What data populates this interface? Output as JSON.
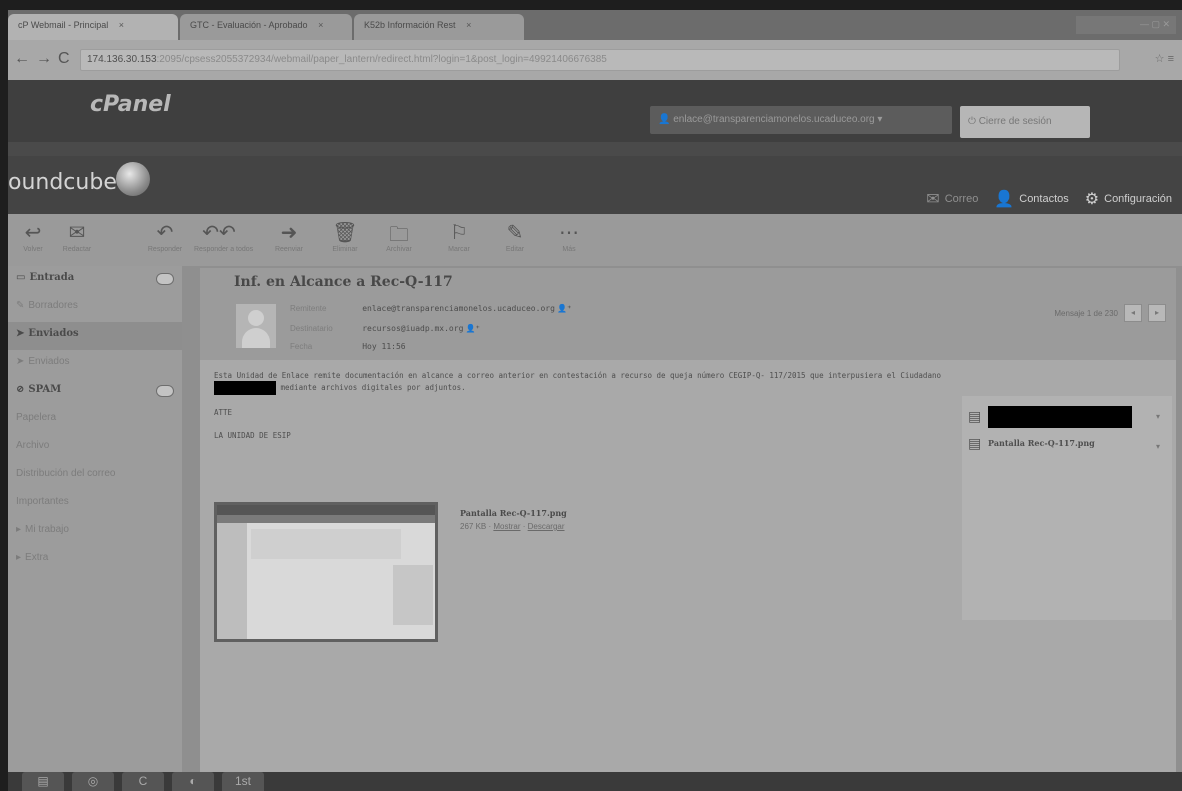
{
  "browser": {
    "tabs": [
      {
        "label": "cP Webmail - Principal",
        "close": "×"
      },
      {
        "label": "GTC - Evaluación - Aprobado",
        "close": "×"
      },
      {
        "label": "K52b Información Rest",
        "close": "×"
      }
    ],
    "url_host": "174.136.30.153",
    "url_path": ":2095/cpsess2055372934/webmail/paper_lantern/redirect.html?login=1&post_login=49921406676385",
    "window_controls": "— ▢ ✕"
  },
  "cpanel": {
    "logo": "cPanel",
    "user": "enlace@transparenciamonelos.ucaduceo.org ▾",
    "logout": "Cierre de sesión"
  },
  "roundcube": {
    "logo": "oundcube",
    "nav": {
      "mail": "Correo",
      "contacts": "Contactos",
      "settings": "Configuración"
    }
  },
  "toolbar": {
    "items": [
      {
        "icon": "↩",
        "label": "Volver"
      },
      {
        "icon": "✉",
        "label": "Redactar"
      },
      {
        "icon": "↶",
        "label": "Responder"
      },
      {
        "icon": "↶↶",
        "label": "Responder a todos"
      },
      {
        "icon": "➜",
        "label": "Reenviar"
      },
      {
        "icon": "🗑",
        "label": "Eliminar"
      },
      {
        "icon": "🗀",
        "label": "Archivar"
      },
      {
        "icon": "⚐",
        "label": "Marcar"
      },
      {
        "icon": "✎",
        "label": "Editar"
      },
      {
        "icon": "⋯",
        "label": "Más"
      }
    ]
  },
  "folders": [
    {
      "label": "Entrada",
      "bold": true,
      "badge": true
    },
    {
      "label": "Borradores",
      "bold": false,
      "badge": false
    },
    {
      "label": "Enviados",
      "bold": true,
      "badge": false,
      "selected": true
    },
    {
      "label": "Enviados",
      "bold": false,
      "badge": false
    },
    {
      "label": "SPAM",
      "bold": true,
      "badge": true
    },
    {
      "label": "Papelera",
      "bold": false,
      "badge": false
    },
    {
      "label": "Archivo",
      "bold": false,
      "badge": false
    },
    {
      "label": "Distribución del correo",
      "bold": false,
      "badge": false
    },
    {
      "label": "Importantes",
      "bold": false,
      "badge": false
    },
    {
      "label": "Mi trabajo",
      "bold": false,
      "badge": false
    },
    {
      "label": "Extra",
      "bold": false,
      "badge": false
    }
  ],
  "message": {
    "subject": "Inf. en Alcance a Rec-Q-117",
    "from_label": "Remitente",
    "from": "enlace@transparenciamonelos.ucaduceo.org",
    "to_label": "Destinatario",
    "to": "recursos@iuadp.mx.org",
    "date_label": "Fecha",
    "date": "Hoy 11:56",
    "pager": "Mensaje 1 de 230",
    "prev": "◂",
    "next": "▸",
    "body_line1_a": "Esta Unidad de Enlace remite documentación en alcance a correo anterior en contestación a recurso de queja número CEGIP-Q-",
    "body_line1_b": "117/2015 que interpusiera el Ciudadano",
    "body_line1_c": "mediante archivos digitales por adjuntos.",
    "body_line2": "ATTE",
    "body_line3": "LA UNIDAD DE ESIP",
    "attachments": [
      {
        "name": "██████████████"
      },
      {
        "name": "Pantalla Rec-Q-117.png"
      }
    ],
    "inline_attachment": {
      "name": "Pantalla Rec-Q-117.png",
      "size": "267 KB",
      "open": "Mostrar",
      "download": "Descargar"
    }
  },
  "taskbar": [
    "▤",
    "◎",
    "C",
    "◐",
    "1st"
  ]
}
